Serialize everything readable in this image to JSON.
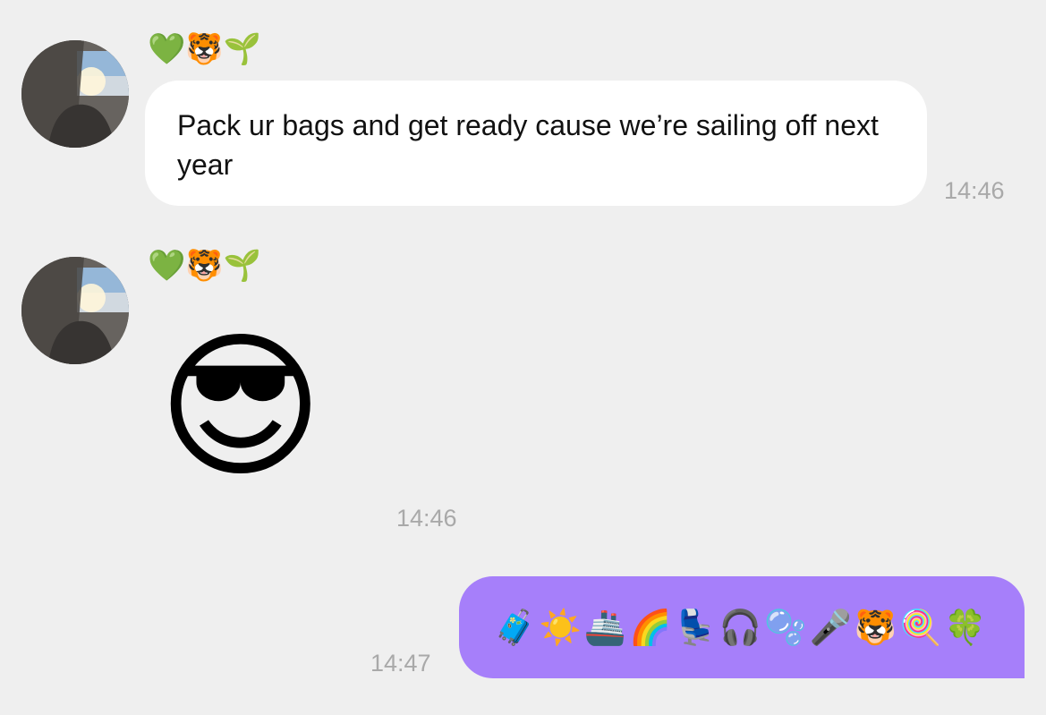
{
  "messages": [
    {
      "sender_name": "💚🐯🌱",
      "avatar": "contact-photo",
      "text": "Pack ur bags and get ready cause we’re sailing off next year",
      "time": "14:46"
    },
    {
      "sender_name": "💚🐯🌱",
      "avatar": "contact-photo",
      "emoji": "😎",
      "time": "14:46"
    },
    {
      "outgoing": true,
      "text": "🧳☀️🚢🌈💺🎧🫧🎤🐯🍭🍀",
      "time": "14:47"
    }
  ],
  "colors": {
    "background": "#efefef",
    "incoming_bubble": "#ffffff",
    "outgoing_bubble": "#a67ffa",
    "timestamp": "#a9a9a9"
  }
}
